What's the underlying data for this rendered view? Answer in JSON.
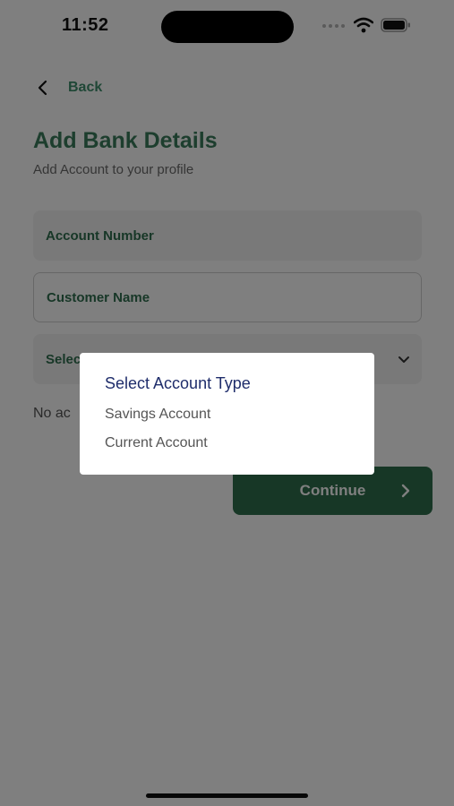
{
  "status_bar": {
    "time": "11:52"
  },
  "header": {
    "back_label": "Back"
  },
  "page": {
    "title": "Add Bank Details",
    "subtitle": "Add Account to your profile"
  },
  "form": {
    "account_number_placeholder": "Account Number",
    "customer_name_placeholder": "Customer Name",
    "account_type_placeholder": "Select Account Type",
    "account_type_visible": "Selec",
    "no_accounts_text": "No ac",
    "continue_label": "Continue"
  },
  "dialog": {
    "title": "Select Account Type",
    "options": [
      "Savings Account",
      "Current Account"
    ]
  },
  "colors": {
    "accent_green": "#3a7d5c",
    "button_green": "#2f6e4c",
    "dialog_title": "#1f2d6b"
  }
}
